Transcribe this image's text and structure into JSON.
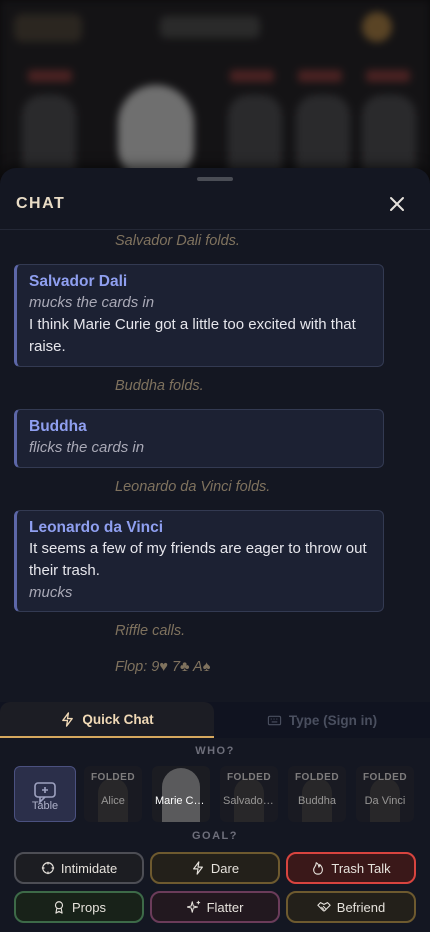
{
  "sheet": {
    "title": "CHAT"
  },
  "messages": {
    "sys1": "Salvador Dali folds.",
    "dali": {
      "name": "Salvador Dali",
      "action": "mucks the cards in",
      "text": "I think Marie Curie got a little too excited with that raise."
    },
    "sys2": "Buddha folds.",
    "buddha": {
      "name": "Buddha",
      "action": "flicks the cards in"
    },
    "sys3": "Leonardo da Vinci folds.",
    "davinci": {
      "name": "Leonardo da Vinci",
      "text": "It seems a few of my friends are eager to throw out their trash.",
      "action": "mucks"
    },
    "sys4": "Riffle calls.",
    "sys5": "Flop: 9♥ 7♣ A♠"
  },
  "tabs": {
    "quick": "Quick Chat",
    "type": "Type (Sign in)"
  },
  "who": {
    "label": "WHO?",
    "targets": [
      {
        "name": "Table",
        "folded": ""
      },
      {
        "name": "Alice",
        "folded": "FOLDED"
      },
      {
        "name": "Marie Curie",
        "folded": ""
      },
      {
        "name": "Salvador Dali",
        "folded": "FOLDED"
      },
      {
        "name": "Buddha",
        "folded": "FOLDED"
      },
      {
        "name": "Da Vinci",
        "folded": "FOLDED"
      }
    ]
  },
  "goal": {
    "label": "GOAL?",
    "options": [
      "Intimidate",
      "Dare",
      "Trash Talk",
      "Props",
      "Flatter",
      "Befriend"
    ]
  },
  "colors": {
    "accent": "#d6a85e",
    "player_name": "#8f9ff0",
    "system_text": "#7f725e",
    "trash_talk_border": "#d8443f"
  }
}
